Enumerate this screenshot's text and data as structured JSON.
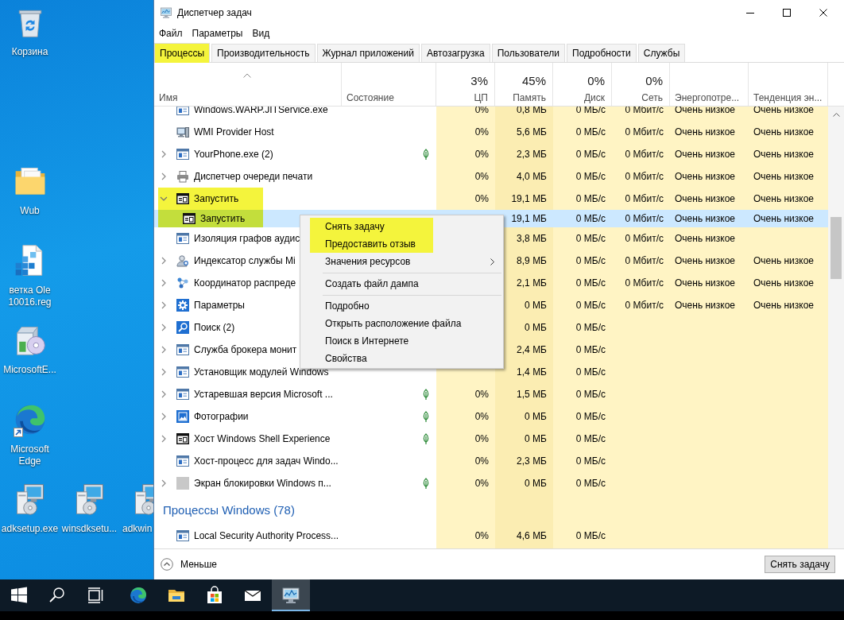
{
  "desktop": {
    "icons": [
      {
        "label": "Корзина",
        "kind": "bin",
        "shortcut": false
      },
      {
        "label": "Wub",
        "kind": "folder",
        "shortcut": false
      },
      {
        "label": "ветка Ole 10016.reg",
        "kind": "document",
        "shortcut": false
      },
      {
        "label": "MicrosoftE...",
        "kind": "package",
        "shortcut": false
      },
      {
        "label": "Microsoft Edge",
        "kind": "browser",
        "shortcut": true
      },
      {
        "label": "adksetup.exe",
        "kind": "setup",
        "shortcut": false
      },
      {
        "label": "winsdksetu...",
        "kind": "setup",
        "shortcut": false
      },
      {
        "label": "adkwin",
        "kind": "setup",
        "shortcut": false
      }
    ]
  },
  "window": {
    "title": "Диспетчер задач",
    "menu": [
      "Файл",
      "Параметры",
      "Вид"
    ],
    "tabs": [
      {
        "label": "Процессы",
        "selected": true,
        "highlighted": true
      },
      {
        "label": "Производительность",
        "selected": false,
        "highlighted": false
      },
      {
        "label": "Журнал приложений",
        "selected": false,
        "highlighted": false
      },
      {
        "label": "Автозагрузка",
        "selected": false,
        "highlighted": false
      },
      {
        "label": "Пользователи",
        "selected": false,
        "highlighted": false
      },
      {
        "label": "Подробности",
        "selected": false,
        "highlighted": false
      },
      {
        "label": "Службы",
        "selected": false,
        "highlighted": false
      }
    ],
    "columns": [
      {
        "label": "Имя",
        "kind": "name",
        "sorted": true
      },
      {
        "label": "Состояние",
        "kind": "status",
        "sorted": false
      },
      {
        "label": "ЦП",
        "kind": "number",
        "total": "3%",
        "sorted": false
      },
      {
        "label": "Память",
        "kind": "number",
        "total": "45%",
        "sorted": false
      },
      {
        "label": "Диск",
        "kind": "number",
        "total": "0%",
        "sorted": false
      },
      {
        "label": "Сеть",
        "kind": "number",
        "total": "0%",
        "sorted": false
      },
      {
        "label": "Энергопотре...",
        "kind": "text",
        "sorted": false
      },
      {
        "label": "Тенденция эн...",
        "kind": "text",
        "sorted": false
      }
    ],
    "rows": [
      {
        "kind": "window",
        "name": "Windows.WARP.JITService.exe",
        "expandable": false,
        "suspended": false,
        "selected": false,
        "highlighted": false,
        "cells": [
          "0%",
          "0,8 МБ",
          "0 МБ/с",
          "0 Мбит/с",
          "Очень низкое",
          "Очень низкое"
        ]
      },
      {
        "kind": "computer",
        "name": "WMI Provider Host",
        "expandable": false,
        "suspended": false,
        "selected": false,
        "highlighted": false,
        "cells": [
          "0%",
          "5,6 МБ",
          "0 МБ/с",
          "0 Мбит/с",
          "Очень низкое",
          "Очень низкое"
        ]
      },
      {
        "kind": "window",
        "name": "YourPhone.exe (2)",
        "expandable": true,
        "expanded": false,
        "suspended": true,
        "selected": false,
        "highlighted": false,
        "cells": [
          "0%",
          "2,3 МБ",
          "0 МБ/с",
          "0 Мбит/с",
          "Очень низкое",
          "Очень низкое"
        ]
      },
      {
        "kind": "printer",
        "name": "Диспетчер очереди печати",
        "expandable": true,
        "expanded": false,
        "suspended": false,
        "selected": false,
        "highlighted": false,
        "cells": [
          "0%",
          "4,0 МБ",
          "0 МБ/с",
          "0 Мбит/с",
          "Очень низкое",
          "Очень низкое"
        ]
      },
      {
        "kind": "console",
        "name": "Запустить",
        "expandable": true,
        "expanded": true,
        "suspended": false,
        "selected": false,
        "highlighted": true,
        "cells": [
          "0%",
          "19,1 МБ",
          "0 МБ/с",
          "0 Мбит/с",
          "Очень низкое",
          "Очень низкое"
        ],
        "children": [
          {
            "kind": "console",
            "name": "Запустить",
            "expandable": false,
            "selected": true,
            "highlighted": true,
            "cells": [
              null,
              "19,1 МБ",
              "0 МБ/с",
              "0 Мбит/с",
              "Очень низкое",
              "Очень низкое"
            ]
          }
        ]
      },
      {
        "kind": "window",
        "name": "Изоляция графов аудис",
        "expandable": false,
        "selected": false,
        "highlighted": false,
        "cells": [
          null,
          "3,8 МБ",
          "0 МБ/с",
          "0 Мбит/с",
          "Очень низкое",
          null
        ]
      },
      {
        "kind": "person",
        "name": "Индексатор службы Mi",
        "expandable": true,
        "expanded": false,
        "selected": false,
        "highlighted": false,
        "cells": [
          null,
          "8,9 МБ",
          "0 МБ/с",
          "0 Мбит/с",
          "Очень низкое",
          "Очень низкое"
        ]
      },
      {
        "kind": "network",
        "name": "Координатор распреде",
        "expandable": true,
        "expanded": false,
        "selected": false,
        "highlighted": false,
        "cells": [
          null,
          "2,1 МБ",
          "0 МБ/с",
          "0 Мбит/с",
          "Очень низкое",
          "Очень низкое"
        ]
      },
      {
        "kind": "gear",
        "name": "Параметры",
        "expandable": true,
        "expanded": false,
        "selected": false,
        "highlighted": false,
        "cells": [
          null,
          "0 МБ",
          "0 МБ/с",
          "0 Мбит/с",
          "Очень низкое",
          "Очень низкое"
        ]
      },
      {
        "kind": "search",
        "name": "Поиск (2)",
        "expandable": true,
        "expanded": false,
        "selected": false,
        "highlighted": false,
        "cells": [
          null,
          "0 МБ",
          "0 МБ/с",
          null,
          null,
          null
        ]
      },
      {
        "kind": "window",
        "name": "Служба брокера монит",
        "expandable": true,
        "expanded": false,
        "selected": false,
        "highlighted": false,
        "cells": [
          null,
          "2,4 МБ",
          "0 МБ/с",
          null,
          null,
          null
        ]
      },
      {
        "kind": "window",
        "name": "Установщик модулей Windows",
        "expandable": true,
        "expanded": false,
        "suspended": false,
        "selected": false,
        "highlighted": false,
        "cells": [
          null,
          "1,4 МБ",
          "0 МБ/с",
          null,
          null,
          null
        ]
      },
      {
        "kind": "window",
        "name": "Устаревшая версия Microsoft ...",
        "expandable": true,
        "expanded": false,
        "suspended": true,
        "selected": false,
        "highlighted": false,
        "cells": [
          "0%",
          "1,5 МБ",
          "0 МБ/с",
          null,
          null,
          null
        ]
      },
      {
        "kind": "photo",
        "name": "Фотографии",
        "expandable": true,
        "expanded": false,
        "suspended": true,
        "selected": false,
        "highlighted": false,
        "cells": [
          "0%",
          "0 МБ",
          "0 МБ/с",
          null,
          null,
          null
        ]
      },
      {
        "kind": "console",
        "name": "Хост Windows Shell Experience",
        "expandable": true,
        "expanded": false,
        "suspended": true,
        "selected": false,
        "highlighted": false,
        "cells": [
          "0%",
          "0 МБ",
          "0 МБ/с",
          null,
          null,
          null
        ]
      },
      {
        "kind": "window",
        "name": "Хост-процесс для задач Windo...",
        "expandable": false,
        "suspended": false,
        "selected": false,
        "highlighted": false,
        "cells": [
          "0%",
          "2,3 МБ",
          "0 МБ/с",
          null,
          null,
          null
        ]
      },
      {
        "kind": "tile",
        "name": "Экран блокировки Windows п...",
        "expandable": true,
        "expanded": false,
        "suspended": true,
        "selected": false,
        "highlighted": false,
        "cells": [
          "0%",
          "0 МБ",
          "0 МБ/с",
          null,
          null,
          null
        ]
      },
      {
        "kind": "group",
        "label": "Процессы Windows (78)"
      },
      {
        "kind": "window",
        "name": "Local Security Authority Process...",
        "expandable": false,
        "suspended": false,
        "selected": false,
        "highlighted": false,
        "cells": [
          "0%",
          "4,6 МБ",
          "0 МБ/с",
          null,
          null,
          null
        ]
      }
    ],
    "context_menu": {
      "items": [
        {
          "kind": "item",
          "label": "Снять задачу",
          "highlighted": true,
          "submenu": false
        },
        {
          "kind": "item",
          "label": "Предоставить отзыв",
          "highlighted": true,
          "submenu": false
        },
        {
          "kind": "item",
          "label": "Значения ресурсов",
          "highlighted": false,
          "submenu": true
        },
        {
          "kind": "separator"
        },
        {
          "kind": "item",
          "label": "Создать файл дампа",
          "highlighted": false,
          "submenu": false
        },
        {
          "kind": "separator"
        },
        {
          "kind": "item",
          "label": "Подробно",
          "highlighted": false,
          "submenu": false
        },
        {
          "kind": "item",
          "label": "Открыть расположение файла",
          "highlighted": false,
          "submenu": false
        },
        {
          "kind": "item",
          "label": "Поиск в Интернете",
          "highlighted": false,
          "submenu": false
        },
        {
          "kind": "item",
          "label": "Свойства",
          "highlighted": false,
          "submenu": false
        }
      ]
    },
    "footer": {
      "toggle": "Меньше",
      "button": "Снять задачу"
    }
  },
  "taskbar": {
    "items": [
      {
        "kind": "start",
        "active": false
      },
      {
        "kind": "search",
        "active": false
      },
      {
        "kind": "taskview",
        "active": false
      },
      {
        "kind": "browser",
        "active": false
      },
      {
        "kind": "explorer",
        "active": false
      },
      {
        "kind": "store",
        "active": false
      },
      {
        "kind": "mail",
        "active": false
      },
      {
        "kind": "taskmgr",
        "active": true
      }
    ]
  }
}
